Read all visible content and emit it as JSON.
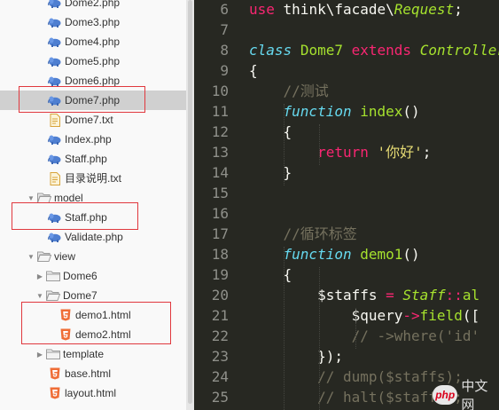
{
  "tree": [
    {
      "label": "Dome2.php",
      "icon": "php-icon",
      "depth": 2
    },
    {
      "label": "Dome3.php",
      "icon": "php-icon",
      "depth": 2
    },
    {
      "label": "Dome4.php",
      "icon": "php-icon",
      "depth": 2
    },
    {
      "label": "Dome5.php",
      "icon": "php-icon",
      "depth": 2
    },
    {
      "label": "Dome6.php",
      "icon": "php-icon",
      "depth": 2
    },
    {
      "label": "Dome7.php",
      "icon": "php-icon",
      "depth": 2,
      "selected": true
    },
    {
      "label": "Dome7.txt",
      "icon": "text-file-icon",
      "depth": 2
    },
    {
      "label": "Index.php",
      "icon": "php-icon",
      "depth": 2
    },
    {
      "label": "Staff.php",
      "icon": "php-icon",
      "depth": 2
    },
    {
      "label": "目录说明.txt",
      "icon": "text-file-icon",
      "depth": 2
    },
    {
      "label": "model",
      "icon": "folder-open-icon",
      "depth": 1,
      "expanded": true
    },
    {
      "label": "Staff.php",
      "icon": "php-icon",
      "depth": 2
    },
    {
      "label": "Validate.php",
      "icon": "php-icon",
      "depth": 2
    },
    {
      "label": "view",
      "icon": "folder-open-icon",
      "depth": 1,
      "expanded": true
    },
    {
      "label": "Dome6",
      "icon": "folder-icon",
      "depth": 2,
      "expanded": false
    },
    {
      "label": "Dome7",
      "icon": "folder-open-icon",
      "depth": 2,
      "expanded": true
    },
    {
      "label": "demo1.html",
      "icon": "html5-icon",
      "depth": 3
    },
    {
      "label": "demo2.html",
      "icon": "html5-icon",
      "depth": 3
    },
    {
      "label": "template",
      "icon": "folder-icon",
      "depth": 2,
      "expanded": false
    },
    {
      "label": "base.html",
      "icon": "html5-icon",
      "depth": 2
    },
    {
      "label": "layout.html",
      "icon": "html5-icon",
      "depth": 2
    }
  ],
  "code": [
    {
      "line": "6",
      "tokens": [
        {
          "t": "use",
          "c": "kw"
        },
        {
          "t": " think\\facade\\",
          "c": "pl"
        },
        {
          "t": "Request",
          "c": "cls-i"
        },
        {
          "t": ";",
          "c": "pl"
        }
      ]
    },
    {
      "line": "7",
      "tokens": []
    },
    {
      "line": "8",
      "tokens": [
        {
          "t": "class",
          "c": "kw-i"
        },
        {
          "t": " ",
          "c": "pl"
        },
        {
          "t": "Dome7",
          "c": "cls"
        },
        {
          "t": " ",
          "c": "pl"
        },
        {
          "t": "extends",
          "c": "kw"
        },
        {
          "t": " ",
          "c": "pl"
        },
        {
          "t": "Controller",
          "c": "cls-i"
        }
      ]
    },
    {
      "line": "9",
      "tokens": [
        {
          "t": "{",
          "c": "pl"
        }
      ]
    },
    {
      "line": "10",
      "tokens": [
        {
          "t": "    //测试",
          "c": "cm"
        }
      ]
    },
    {
      "line": "11",
      "tokens": [
        {
          "t": "    ",
          "c": "pl"
        },
        {
          "t": "function",
          "c": "kw-i"
        },
        {
          "t": " ",
          "c": "pl"
        },
        {
          "t": "index",
          "c": "fn"
        },
        {
          "t": "()",
          "c": "pl"
        }
      ]
    },
    {
      "line": "12",
      "tokens": [
        {
          "t": "    {",
          "c": "pl"
        }
      ]
    },
    {
      "line": "13",
      "tokens": [
        {
          "t": "        ",
          "c": "pl"
        },
        {
          "t": "return",
          "c": "kw"
        },
        {
          "t": " ",
          "c": "pl"
        },
        {
          "t": "'你好'",
          "c": "str"
        },
        {
          "t": ";",
          "c": "pl"
        }
      ]
    },
    {
      "line": "14",
      "tokens": [
        {
          "t": "    }",
          "c": "pl"
        }
      ]
    },
    {
      "line": "15",
      "tokens": []
    },
    {
      "line": "16",
      "tokens": []
    },
    {
      "line": "17",
      "tokens": [
        {
          "t": "    //循环标签",
          "c": "cm"
        }
      ]
    },
    {
      "line": "18",
      "tokens": [
        {
          "t": "    ",
          "c": "pl"
        },
        {
          "t": "function",
          "c": "kw-i"
        },
        {
          "t": " ",
          "c": "pl"
        },
        {
          "t": "demo1",
          "c": "fn"
        },
        {
          "t": "()",
          "c": "pl"
        }
      ]
    },
    {
      "line": "19",
      "tokens": [
        {
          "t": "    {",
          "c": "pl"
        }
      ]
    },
    {
      "line": "20",
      "tokens": [
        {
          "t": "        $staffs ",
          "c": "var"
        },
        {
          "t": "=",
          "c": "kw"
        },
        {
          "t": " ",
          "c": "pl"
        },
        {
          "t": "Staff",
          "c": "cls-i"
        },
        {
          "t": "::",
          "c": "kw"
        },
        {
          "t": "al",
          "c": "fn"
        }
      ]
    },
    {
      "line": "21",
      "tokens": [
        {
          "t": "            $query",
          "c": "var"
        },
        {
          "t": "->",
          "c": "kw"
        },
        {
          "t": "field",
          "c": "fn"
        },
        {
          "t": "([",
          "c": "pl"
        }
      ]
    },
    {
      "line": "22",
      "tokens": [
        {
          "t": "            // ->where('id'",
          "c": "cm"
        }
      ]
    },
    {
      "line": "23",
      "tokens": [
        {
          "t": "        });",
          "c": "pl"
        }
      ]
    },
    {
      "line": "24",
      "tokens": [
        {
          "t": "        // dump($staffs);",
          "c": "cm"
        }
      ]
    },
    {
      "line": "25",
      "tokens": [
        {
          "t": "        // halt($staffs);",
          "c": "cm"
        }
      ]
    }
  ],
  "watermark": {
    "badge": "php",
    "text": "中文网"
  },
  "colors": {
    "editor_bg": "#272822",
    "highlight_border": "#e0383e",
    "selection_bg": "#d0d0d0"
  }
}
